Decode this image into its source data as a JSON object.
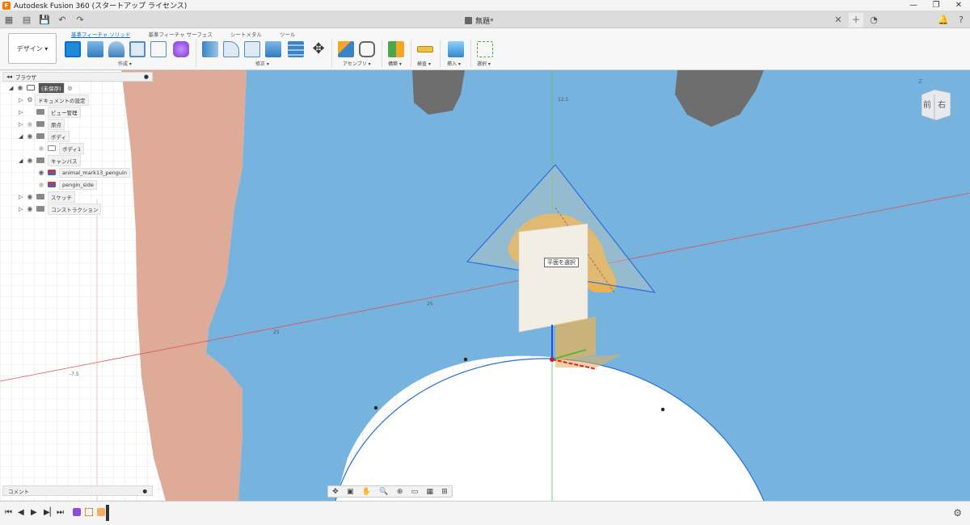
{
  "window": {
    "title": "Autodesk Fusion 360 (スタートアップ ライセンス)",
    "controls": [
      "—",
      "❐",
      "✕"
    ]
  },
  "tabbar": {
    "document_title": "無題*"
  },
  "toolbar": {
    "workspace": "デザイン ▾",
    "tabs": [
      "基準フィーチャ ソリッド",
      "基準フィーチャ サーフェス",
      "シートメタル",
      "ツール"
    ],
    "groups": {
      "create": "作成 ▾",
      "modify": "修正 ▾",
      "assemble": "アセンブリ ▾",
      "construct": "構築 ▾",
      "inspect": "検査 ▾",
      "insert": "挿入 ▾",
      "select": "選択 ▾"
    }
  },
  "browser": {
    "title": "ブラウザ",
    "root": "(未保存)",
    "items": [
      {
        "label": "ドキュメントの設定"
      },
      {
        "label": "ビュー管理"
      },
      {
        "label": "原点"
      },
      {
        "label": "ボディ"
      },
      {
        "label": "ボディ1"
      },
      {
        "label": "キャンバス"
      },
      {
        "label": "animal_mark13_penguin"
      },
      {
        "label": "pengin_side"
      },
      {
        "label": "スケッチ"
      },
      {
        "label": "コンストラクション"
      }
    ]
  },
  "comments": {
    "label": "コメント"
  },
  "viewport": {
    "plane_prompt": "平面を選択",
    "viewcube": {
      "front": "前",
      "right": "右",
      "top_axis": "Z"
    },
    "axis_labels": {
      "label_a": "25",
      "label_b": "25",
      "label_c": "12.5",
      "label_d": "-7.5"
    }
  },
  "colors": {
    "canvas_blue": "#6aaedc",
    "canvas_salmon": "#d9a28c",
    "accent": "#0a6ed1"
  }
}
